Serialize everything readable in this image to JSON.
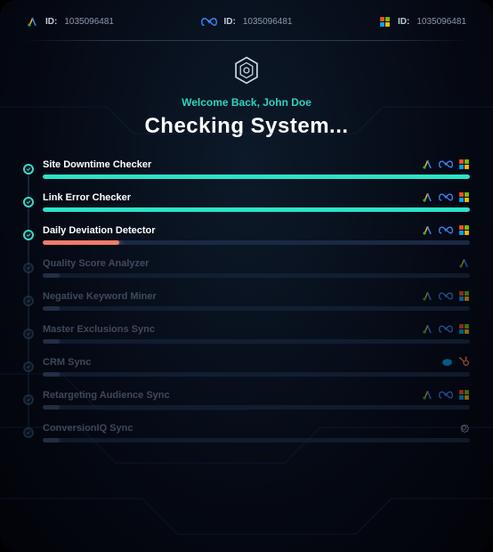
{
  "topbar": {
    "google": {
      "label": "ID:",
      "value": "1035096481"
    },
    "meta": {
      "label": "ID:",
      "value": "1035096481"
    },
    "ms": {
      "label": "ID:",
      "value": "1035096481"
    }
  },
  "welcome": "Welcome Back, John Doe",
  "title": "Checking System...",
  "colors": {
    "teal": "#2be3c8",
    "coral": "#f47b6a",
    "dim": "#3a4d6b"
  },
  "checks": [
    {
      "label": "Site Downtime Checker",
      "progress": 100,
      "color": "teal",
      "active": true,
      "icons": [
        "google",
        "meta",
        "ms"
      ]
    },
    {
      "label": "Link Error Checker",
      "progress": 100,
      "color": "teal",
      "active": true,
      "icons": [
        "google",
        "meta",
        "ms"
      ]
    },
    {
      "label": "Daily Deviation Detector",
      "progress": 18,
      "color": "coral",
      "active": true,
      "icons": [
        "google",
        "meta",
        "ms"
      ]
    },
    {
      "label": "Quality Score Analyzer",
      "progress": 4,
      "color": "dim",
      "active": false,
      "icons": [
        "google"
      ]
    },
    {
      "label": "Negative Keyword Miner",
      "progress": 4,
      "color": "dim",
      "active": false,
      "icons": [
        "google",
        "meta",
        "ms"
      ]
    },
    {
      "label": "Master Exclusions Sync",
      "progress": 4,
      "color": "dim",
      "active": false,
      "icons": [
        "google",
        "meta",
        "ms"
      ]
    },
    {
      "label": "CRM Sync",
      "progress": 4,
      "color": "dim",
      "active": false,
      "icons": [
        "salesforce",
        "hubspot"
      ]
    },
    {
      "label": "Retargeting Audience Sync",
      "progress": 4,
      "color": "dim",
      "active": false,
      "icons": [
        "google",
        "meta",
        "ms"
      ]
    },
    {
      "label": "ConversionIQ Sync",
      "progress": 4,
      "color": "dim",
      "active": false,
      "icons": [
        "gear"
      ]
    }
  ]
}
